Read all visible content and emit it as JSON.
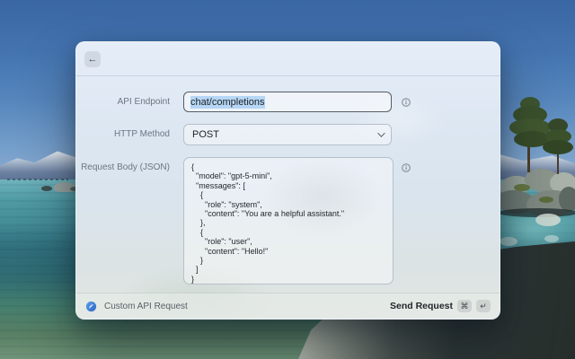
{
  "dialog": {
    "back_icon": "←",
    "form": {
      "fields": [
        {
          "label": "API Endpoint",
          "value": "chat/completions",
          "has_info": true
        },
        {
          "label": "HTTP Method",
          "value": "POST",
          "has_info": false
        },
        {
          "label": "Request Body (JSON)",
          "value": "{\n  \"model\": \"gpt-5-mini\",\n  \"messages\": [\n    {\n      \"role\": \"system\",\n      \"content\": \"You are a helpful assistant.\"\n    },\n    {\n      \"role\": \"user\",\n      \"content\": \"Hello!\"\n    }\n  ]\n}",
          "has_info": true
        }
      ]
    },
    "footer": {
      "source_label": "Custom API Request",
      "submit_label": "Send Request",
      "shortcut_keys": [
        "⌘",
        "↵"
      ]
    }
  },
  "colors": {
    "selection_highlight": "#b5d6f4",
    "footer_icon_blue": "#3c82d8",
    "sky_top": "#3a66a4",
    "water_teal": "#3f8691"
  }
}
